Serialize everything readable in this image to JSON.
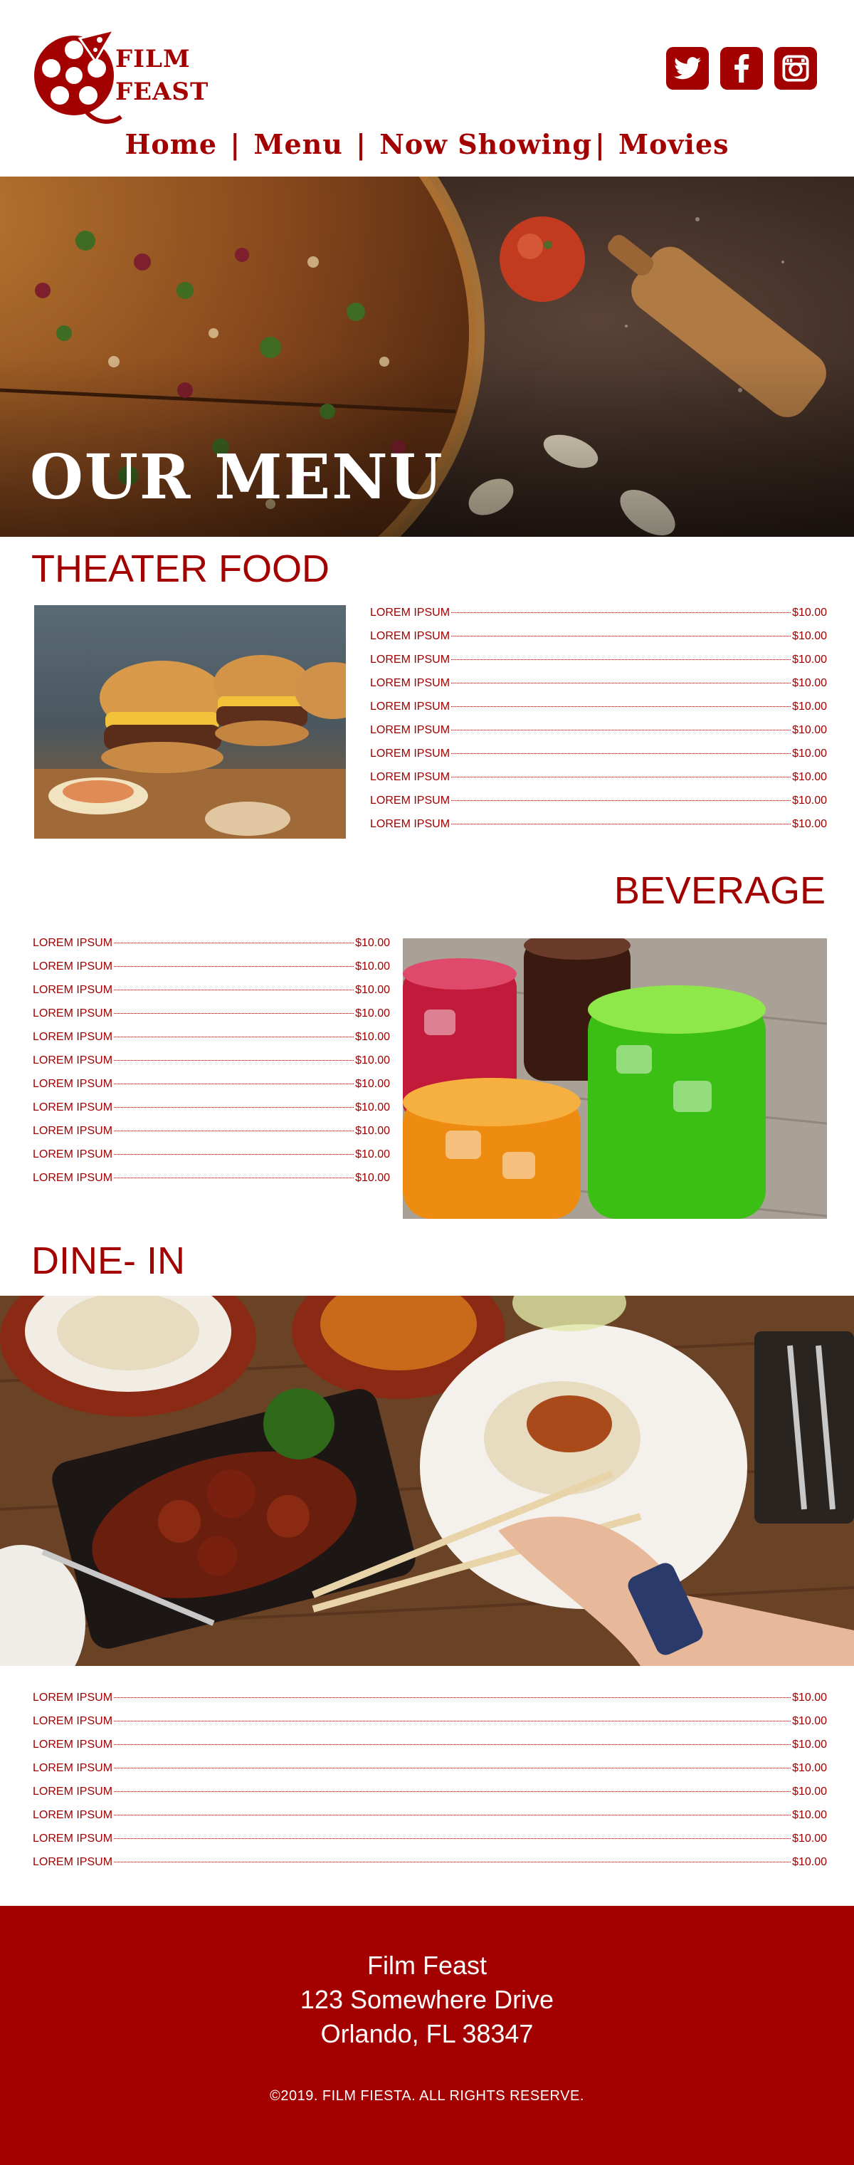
{
  "header": {
    "logo_line1": "FILM",
    "logo_line2": "FEAST",
    "social": [
      {
        "icon": "twitter-icon"
      },
      {
        "icon": "facebook-icon"
      },
      {
        "icon": "instagram-icon"
      }
    ],
    "nav": [
      "Home",
      "Menu",
      "Now Showing",
      "Movies"
    ],
    "nav_separator": "|"
  },
  "hero": {
    "title": "OUR MENU"
  },
  "sections": {
    "theater_food": {
      "title": "THEATER FOOD",
      "items": [
        {
          "name": "LOREM IPSUM",
          "price": "$10.00"
        },
        {
          "name": "LOREM IPSUM",
          "price": "$10.00"
        },
        {
          "name": "LOREM IPSUM",
          "price": "$10.00"
        },
        {
          "name": "LOREM IPSUM",
          "price": "$10.00"
        },
        {
          "name": "LOREM IPSUM",
          "price": "$10.00"
        },
        {
          "name": "LOREM IPSUM",
          "price": "$10.00"
        },
        {
          "name": "LOREM IPSUM",
          "price": "$10.00"
        },
        {
          "name": "LOREM IPSUM",
          "price": "$10.00"
        },
        {
          "name": "LOREM IPSUM",
          "price": "$10.00"
        },
        {
          "name": "LOREM IPSUM",
          "price": "$10.00"
        }
      ]
    },
    "beverage": {
      "title": "BEVERAGE",
      "items": [
        {
          "name": "LOREM IPSUM",
          "price": "$10.00"
        },
        {
          "name": "LOREM IPSUM",
          "price": "$10.00"
        },
        {
          "name": "LOREM IPSUM",
          "price": "$10.00"
        },
        {
          "name": "LOREM IPSUM",
          "price": "$10.00"
        },
        {
          "name": "LOREM IPSUM",
          "price": "$10.00"
        },
        {
          "name": "LOREM IPSUM",
          "price": "$10.00"
        },
        {
          "name": "LOREM IPSUM",
          "price": "$10.00"
        },
        {
          "name": "LOREM IPSUM",
          "price": "$10.00"
        },
        {
          "name": "LOREM IPSUM",
          "price": "$10.00"
        },
        {
          "name": "LOREM IPSUM",
          "price": "$10.00"
        },
        {
          "name": "LOREM IPSUM",
          "price": "$10.00"
        }
      ]
    },
    "dine_in": {
      "title": "DINE- IN",
      "items": [
        {
          "name": "LOREM IPSUM",
          "price": "$10.00"
        },
        {
          "name": "LOREM IPSUM",
          "price": "$10.00"
        },
        {
          "name": "LOREM IPSUM",
          "price": "$10.00"
        },
        {
          "name": "LOREM IPSUM",
          "price": "$10.00"
        },
        {
          "name": "LOREM IPSUM",
          "price": "$10.00"
        },
        {
          "name": "LOREM IPSUM",
          "price": "$10.00"
        },
        {
          "name": "LOREM IPSUM",
          "price": "$10.00"
        },
        {
          "name": "LOREM IPSUM",
          "price": "$10.00"
        }
      ]
    }
  },
  "footer": {
    "name": "Film Feast",
    "street": "123 Somewhere Drive",
    "city": "Orlando, FL 38347",
    "copyright": "©2019. FILM FIESTA. ALL RIGHTS RESERVE."
  },
  "colors": {
    "brand": "#a30000",
    "text": "#a00000",
    "background": "#ffffff"
  }
}
